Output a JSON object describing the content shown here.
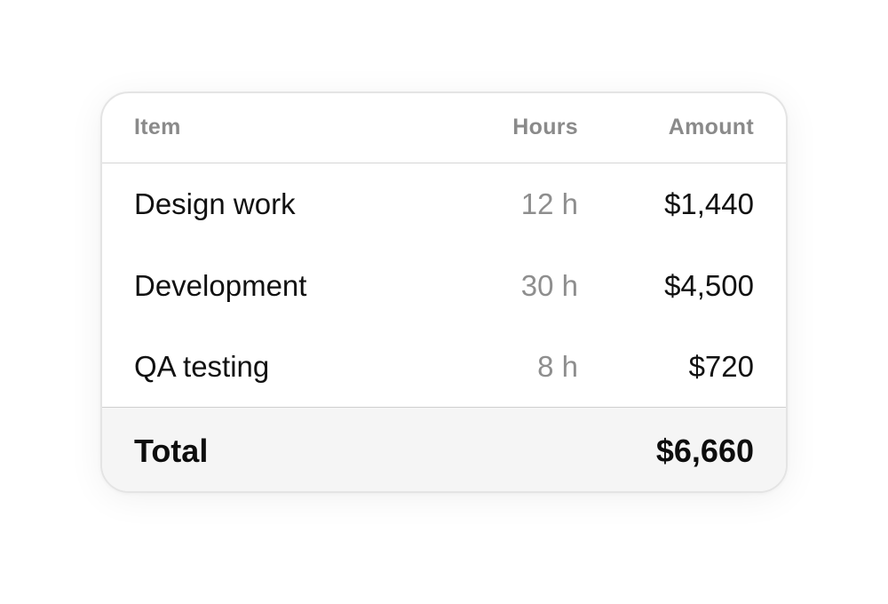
{
  "table": {
    "headers": {
      "item": "Item",
      "hours": "Hours",
      "amount": "Amount"
    },
    "rows": [
      {
        "item": "Design work",
        "hours": "12 h",
        "amount": "$1,440"
      },
      {
        "item": "Development",
        "hours": "30 h",
        "amount": "$4,500"
      },
      {
        "item": "QA testing",
        "hours": "8 h",
        "amount": "$720"
      }
    ],
    "total": {
      "label": "Total",
      "amount": "$6,660"
    }
  },
  "colors": {
    "header_text": "#8a8a8a",
    "hours_text": "#8e8e8e",
    "total_background": "#f5f5f5",
    "border": "#e4e4e4"
  }
}
